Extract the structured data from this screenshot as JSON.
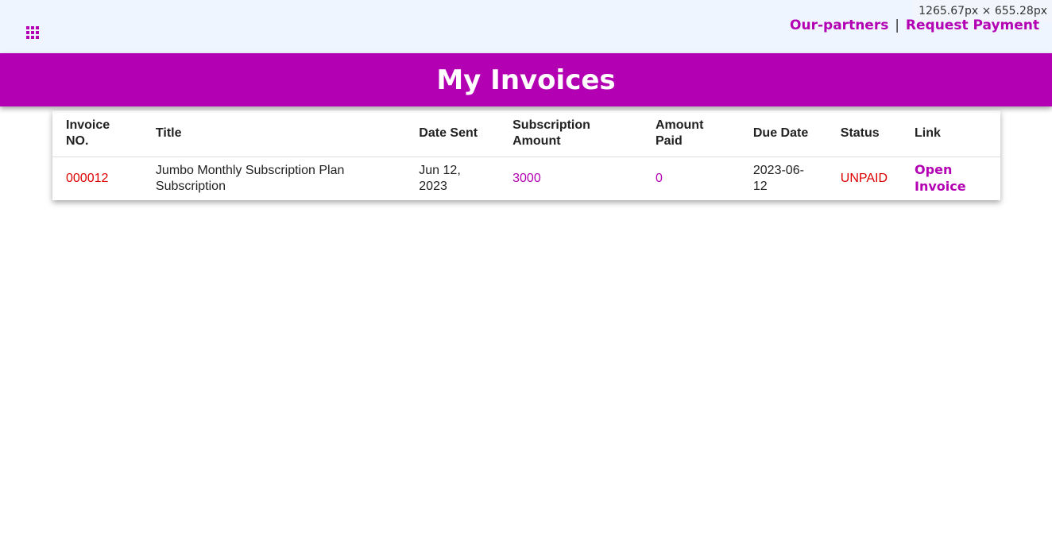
{
  "window": {
    "size_readout": "1265.67px × 655.28px"
  },
  "topbar": {
    "apps_icon": "apps-grid-icon",
    "links": [
      {
        "label": "Our-partners"
      },
      {
        "label": "Request Payment"
      }
    ],
    "separator": "|"
  },
  "banner": {
    "title": "My Invoices"
  },
  "table": {
    "headers": [
      "Invoice NO.",
      "Title",
      "Date Sent",
      "Subscription Amount",
      "Amount Paid",
      "Due Date",
      "Status",
      "Link"
    ],
    "rows": [
      {
        "invoice_no": "000012",
        "title": "Jumbo Monthly Subscription Plan Subscription",
        "date_sent": "Jun 12, 2023",
        "subscription_amount": "3000",
        "amount_paid": "0",
        "due_date": "2023-06-12",
        "status": "UNPAID",
        "link": "Open Invoice"
      }
    ]
  },
  "colors": {
    "brand": "#b300b3",
    "topbar_bg": "#eff5fe",
    "unpaid": "#dd0000"
  }
}
